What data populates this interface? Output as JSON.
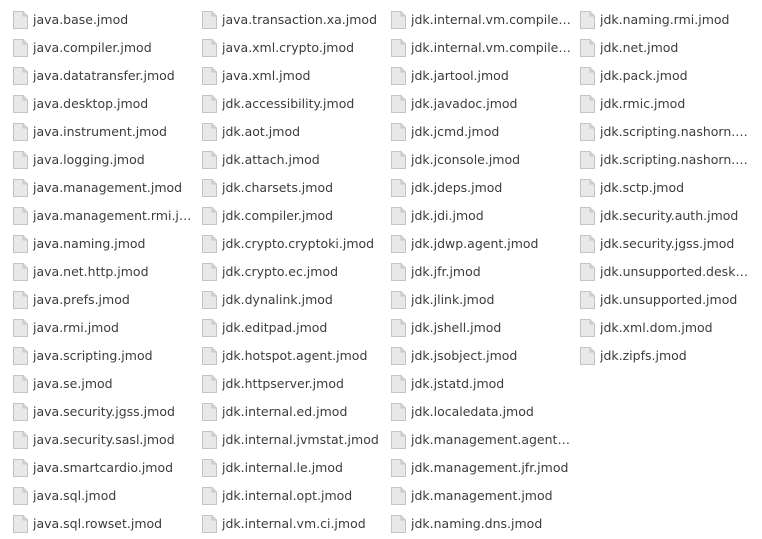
{
  "files": {
    "columns": [
      {
        "items": [
          {
            "label": "java.base.jmod",
            "icon": "file-icon"
          },
          {
            "label": "java.compiler.jmod",
            "icon": "file-icon"
          },
          {
            "label": "java.datatransfer.jmod",
            "icon": "file-icon"
          },
          {
            "label": "java.desktop.jmod",
            "icon": "file-icon"
          },
          {
            "label": "java.instrument.jmod",
            "icon": "file-icon"
          },
          {
            "label": "java.logging.jmod",
            "icon": "file-icon"
          },
          {
            "label": "java.management.jmod",
            "icon": "file-icon"
          },
          {
            "label": "java.management.rmi.jmod",
            "icon": "file-icon"
          },
          {
            "label": "java.naming.jmod",
            "icon": "file-icon"
          },
          {
            "label": "java.net.http.jmod",
            "icon": "file-icon"
          },
          {
            "label": "java.prefs.jmod",
            "icon": "file-icon"
          },
          {
            "label": "java.rmi.jmod",
            "icon": "file-icon"
          },
          {
            "label": "java.scripting.jmod",
            "icon": "file-icon"
          },
          {
            "label": "java.se.jmod",
            "icon": "file-icon"
          },
          {
            "label": "java.security.jgss.jmod",
            "icon": "file-icon"
          },
          {
            "label": "java.security.sasl.jmod",
            "icon": "file-icon"
          },
          {
            "label": "java.smartcardio.jmod",
            "icon": "file-icon"
          },
          {
            "label": "java.sql.jmod",
            "icon": "file-icon"
          },
          {
            "label": "java.sql.rowset.jmod",
            "icon": "file-icon"
          }
        ]
      },
      {
        "items": [
          {
            "label": "java.transaction.xa.jmod",
            "icon": "file-icon"
          },
          {
            "label": "java.xml.crypto.jmod",
            "icon": "file-icon"
          },
          {
            "label": "java.xml.jmod",
            "icon": "file-icon"
          },
          {
            "label": "jdk.accessibility.jmod",
            "icon": "file-icon"
          },
          {
            "label": "jdk.aot.jmod",
            "icon": "file-icon"
          },
          {
            "label": "jdk.attach.jmod",
            "icon": "file-icon"
          },
          {
            "label": "jdk.charsets.jmod",
            "icon": "file-icon"
          },
          {
            "label": "jdk.compiler.jmod",
            "icon": "file-icon"
          },
          {
            "label": "jdk.crypto.cryptoki.jmod",
            "icon": "file-icon"
          },
          {
            "label": "jdk.crypto.ec.jmod",
            "icon": "file-icon"
          },
          {
            "label": "jdk.dynalink.jmod",
            "icon": "file-icon"
          },
          {
            "label": "jdk.editpad.jmod",
            "icon": "file-icon"
          },
          {
            "label": "jdk.hotspot.agent.jmod",
            "icon": "file-icon"
          },
          {
            "label": "jdk.httpserver.jmod",
            "icon": "file-icon"
          },
          {
            "label": "jdk.internal.ed.jmod",
            "icon": "file-icon"
          },
          {
            "label": "jdk.internal.jvmstat.jmod",
            "icon": "file-icon"
          },
          {
            "label": "jdk.internal.le.jmod",
            "icon": "file-icon"
          },
          {
            "label": "jdk.internal.opt.jmod",
            "icon": "file-icon"
          },
          {
            "label": "jdk.internal.vm.ci.jmod",
            "icon": "file-icon"
          }
        ]
      },
      {
        "items": [
          {
            "label": "jdk.internal.vm.compiler.j…",
            "icon": "file-icon"
          },
          {
            "label": "jdk.internal.vm.compiler.…",
            "icon": "file-icon"
          },
          {
            "label": "jdk.jartool.jmod",
            "icon": "file-icon"
          },
          {
            "label": "jdk.javadoc.jmod",
            "icon": "file-icon"
          },
          {
            "label": "jdk.jcmd.jmod",
            "icon": "file-icon"
          },
          {
            "label": "jdk.jconsole.jmod",
            "icon": "file-icon"
          },
          {
            "label": "jdk.jdeps.jmod",
            "icon": "file-icon"
          },
          {
            "label": "jdk.jdi.jmod",
            "icon": "file-icon"
          },
          {
            "label": "jdk.jdwp.agent.jmod",
            "icon": "file-icon"
          },
          {
            "label": "jdk.jfr.jmod",
            "icon": "file-icon"
          },
          {
            "label": "jdk.jlink.jmod",
            "icon": "file-icon"
          },
          {
            "label": "jdk.jshell.jmod",
            "icon": "file-icon"
          },
          {
            "label": "jdk.jsobject.jmod",
            "icon": "file-icon"
          },
          {
            "label": "jdk.jstatd.jmod",
            "icon": "file-icon"
          },
          {
            "label": "jdk.localedata.jmod",
            "icon": "file-icon"
          },
          {
            "label": "jdk.management.agent.j…",
            "icon": "file-icon"
          },
          {
            "label": "jdk.management.jfr.jmod",
            "icon": "file-icon"
          },
          {
            "label": "jdk.management.jmod",
            "icon": "file-icon"
          },
          {
            "label": "jdk.naming.dns.jmod",
            "icon": "file-icon"
          }
        ]
      },
      {
        "items": [
          {
            "label": "jdk.naming.rmi.jmod",
            "icon": "file-icon"
          },
          {
            "label": "jdk.net.jmod",
            "icon": "file-icon"
          },
          {
            "label": "jdk.pack.jmod",
            "icon": "file-icon"
          },
          {
            "label": "jdk.rmic.jmod",
            "icon": "file-icon"
          },
          {
            "label": "jdk.scripting.nashorn.jmod",
            "icon": "file-icon"
          },
          {
            "label": "jdk.scripting.nashorn.she…",
            "icon": "file-icon"
          },
          {
            "label": "jdk.sctp.jmod",
            "icon": "file-icon"
          },
          {
            "label": "jdk.security.auth.jmod",
            "icon": "file-icon"
          },
          {
            "label": "jdk.security.jgss.jmod",
            "icon": "file-icon"
          },
          {
            "label": "jdk.unsupported.desktop…",
            "icon": "file-icon"
          },
          {
            "label": "jdk.unsupported.jmod",
            "icon": "file-icon"
          },
          {
            "label": "jdk.xml.dom.jmod",
            "icon": "file-icon"
          },
          {
            "label": "jdk.zipfs.jmod",
            "icon": "file-icon"
          }
        ]
      }
    ]
  },
  "colors": {
    "background": "#ffffff",
    "text": "#3c3c3c",
    "icon_fill": "#e8e8e8",
    "icon_stroke": "#c4c4c4",
    "icon_fold": "#d4d4d4"
  }
}
